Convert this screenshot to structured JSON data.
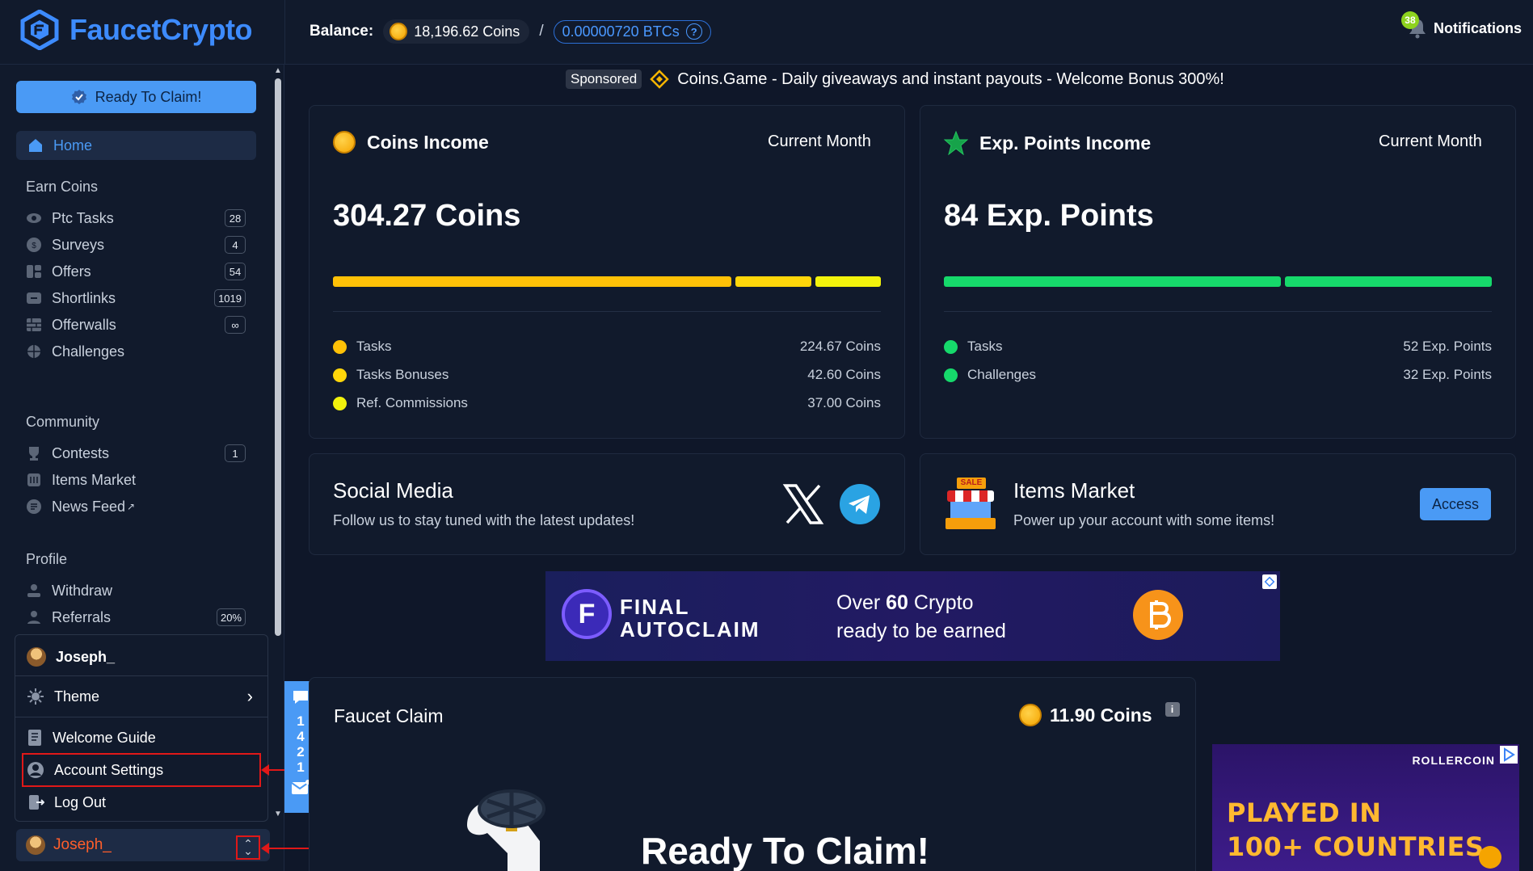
{
  "header": {
    "brand": "FaucetCrypto",
    "balance_label": "Balance:",
    "coins": "18,196.62 Coins",
    "separator": "/",
    "btc": "0.00000720 BTCs",
    "help": "?",
    "notif_count": "38",
    "notifications_label": "Notifications"
  },
  "sidebar": {
    "claim_button": "Ready To Claim!",
    "home": "Home",
    "sections": {
      "earn": "Earn Coins",
      "community": "Community",
      "profile": "Profile"
    },
    "earn_items": [
      {
        "label": "Ptc Tasks",
        "icon": "eye-icon",
        "badge": "28"
      },
      {
        "label": "Surveys",
        "icon": "coin-icon",
        "badge": "4"
      },
      {
        "label": "Offers",
        "icon": "offers-icon",
        "badge": "54"
      },
      {
        "label": "Shortlinks",
        "icon": "link-icon",
        "badge": "1019"
      },
      {
        "label": "Offerwalls",
        "icon": "wall-icon",
        "badge": "∞"
      },
      {
        "label": "Challenges",
        "icon": "target-icon",
        "badge": ""
      }
    ],
    "community_items": [
      {
        "label": "Contests",
        "icon": "trophy-icon",
        "badge": "1"
      },
      {
        "label": "Items Market",
        "icon": "store-icon",
        "badge": ""
      },
      {
        "label": "News Feed",
        "icon": "news-icon",
        "badge": "",
        "external": "↗"
      }
    ],
    "profile_items": [
      {
        "label": "Withdraw",
        "icon": "withdraw-icon",
        "badge": ""
      },
      {
        "label": "Referrals",
        "icon": "referrals-icon",
        "badge": "20%"
      }
    ],
    "user_menu": {
      "username": "Joseph_",
      "theme": "Theme",
      "welcome_guide": "Welcome Guide",
      "account_settings": "Account Settings",
      "log_out": "Log Out"
    },
    "user_bar_name": "Joseph_",
    "side_tab_number": [
      "1",
      "4",
      "2",
      "1"
    ]
  },
  "sponsor": {
    "tag": "Sponsored",
    "text": "Coins.Game - Daily giveaways and instant payouts - Welcome Bonus 300%!"
  },
  "coins_income": {
    "title": "Coins Income",
    "period": "Current Month",
    "total": "304.27 Coins",
    "shares": [
      0.738,
      0.14,
      0.122
    ],
    "rows": [
      {
        "label": "Tasks",
        "value": "224.67 Coins",
        "color": "#ffc107"
      },
      {
        "label": "Tasks Bonuses",
        "value": "42.60 Coins",
        "color": "#ffd60a"
      },
      {
        "label": "Ref. Commissions",
        "value": "37.00 Coins",
        "color": "#f2f20c"
      }
    ]
  },
  "exp_income": {
    "title": "Exp. Points Income",
    "period": "Current Month",
    "total": "84 Exp. Points",
    "shares": [
      0.619,
      0.381
    ],
    "rows": [
      {
        "label": "Tasks",
        "value": "52 Exp. Points",
        "color": "#16d96b"
      },
      {
        "label": "Challenges",
        "value": "32 Exp. Points",
        "color": "#16d96b"
      }
    ]
  },
  "social": {
    "title": "Social Media",
    "desc": "Follow us to stay tuned with the latest updates!"
  },
  "market": {
    "title": "Items Market",
    "desc": "Power up your account with some items!",
    "access": "Access",
    "sale": "SALE"
  },
  "banner": {
    "brand_line1": "FINAL",
    "brand_line2": "AUTOCLAIM",
    "headline_pre": "Over ",
    "headline_num": "60",
    "headline_post": " Crypto",
    "headline_line2": "ready to be earned"
  },
  "faucet": {
    "title": "Faucet Claim",
    "reward": "11.90 Coins",
    "info": "i",
    "ready": "Ready To Claim!"
  },
  "roller_ad": {
    "brand": "ROLLERCOIN",
    "line1": "PLAYED IN",
    "line2": "100+ COUNTRIES"
  },
  "colors": {
    "accent": "#4a9af5",
    "highlight": "#e01818",
    "username": "#ff5e2a"
  }
}
